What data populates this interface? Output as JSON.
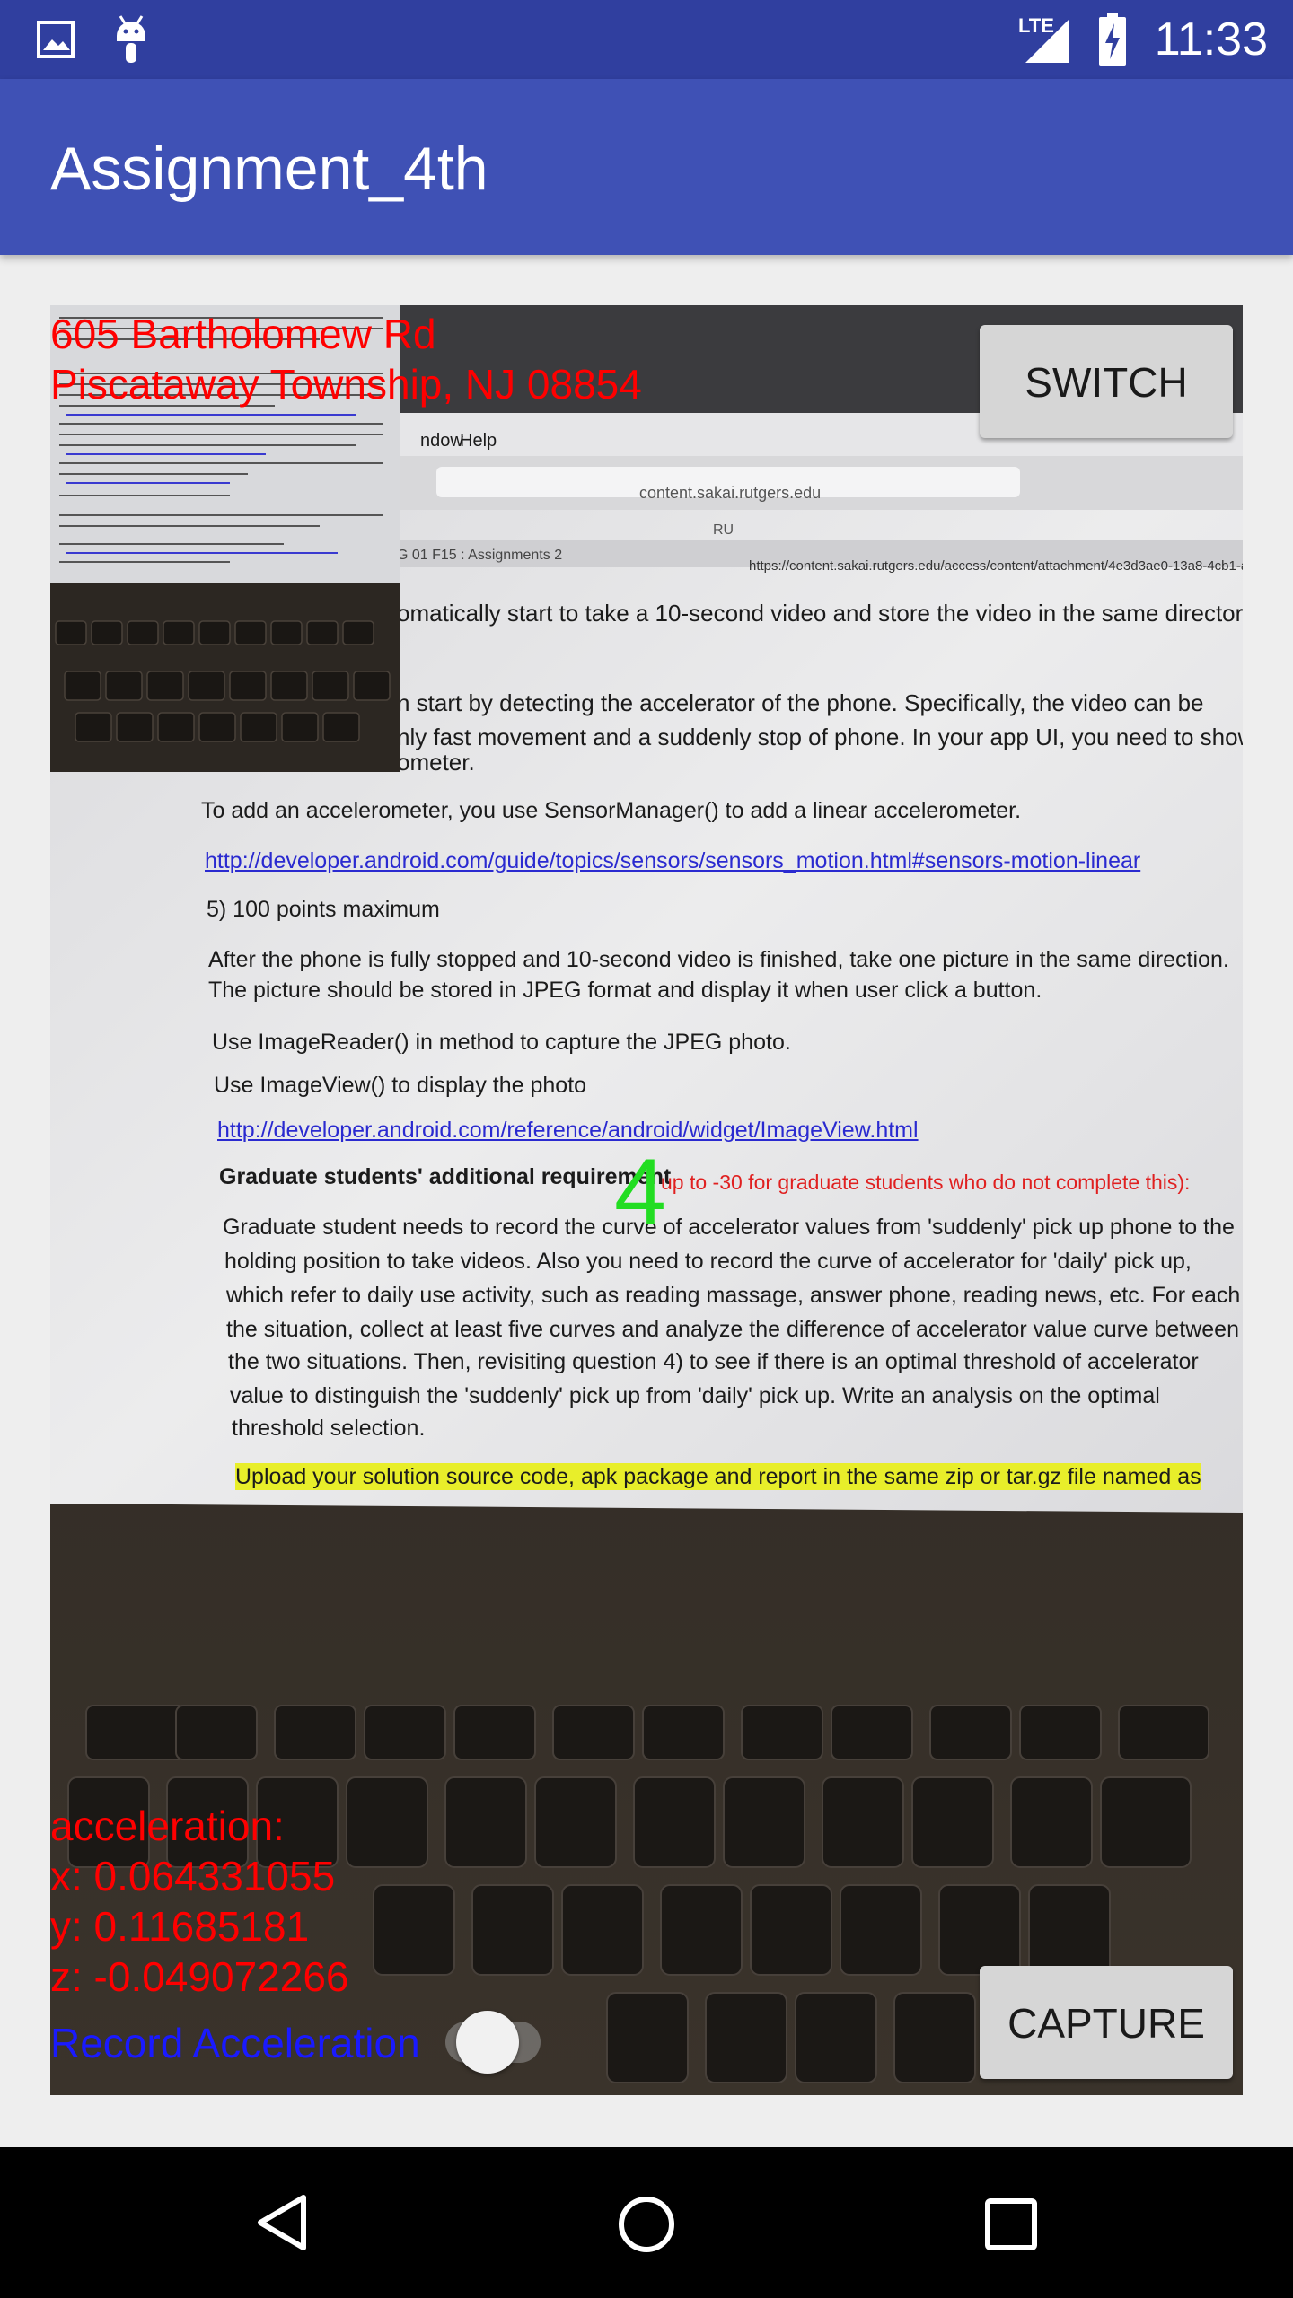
{
  "status_bar": {
    "time": "11:33",
    "network": "LTE",
    "icons": [
      "image-icon",
      "android-icon",
      "signal-icon",
      "battery-charging-icon"
    ]
  },
  "app_bar": {
    "title": "Assignment_4th"
  },
  "camera": {
    "address_line1": "605 Bartholomew Rd",
    "address_line2": "Piscataway Township, NJ 08854",
    "switch_label": "SWITCH",
    "capture_label": "CAPTURE",
    "counter": "4",
    "acceleration": {
      "heading": "acceleration:",
      "x": "x: 0.064331055",
      "y": "y: 0.11685181",
      "z": "z: -0.049072266"
    },
    "record_label": "Record Acceleration",
    "record_enabled": false
  },
  "document": {
    "menu_window": "ndow",
    "menu_help": "Help",
    "url": "content.sakai.rutgers.edu",
    "lang": "RU",
    "tab": "G 01 F15 : Assignments 2",
    "full_url": "https://content.sakai.rutgers.edu/access/content/attachment/4e3d3ae0-13a8-4cb1-a",
    "lines": [
      "omatically start to take a 10-second video and store the video in the same director",
      "n start by detecting the accelerator of the phone. Specifically, the video can be",
      "nly fast movement and a suddenly stop of phone. In your app UI, you need to show",
      "ometer.",
      "To add an accelerometer, you use SensorManager() to add a linear accelerometer."
    ],
    "link1": "http://developer.android.com/guide/topics/sensors/sensors_motion.html#sensors-motion-linear",
    "points": "5) 100 points maximum",
    "para2": [
      "After the phone is fully stopped and 10-second video is finished, take one picture in the same direction.",
      "The picture should be stored in JPEG format and display it when user click a button."
    ],
    "imagereader": "Use ImageReader() in method to capture the JPEG photo.",
    "imageview": "Use ImageView() to display the photo",
    "link2": "http://developer.android.com/reference/android/widget/ImageView.html",
    "grad_heading": "Graduate students' additional requirement",
    "grad_red": "up to -30 for graduate students who do not complete this):",
    "grad_para": [
      "Graduate student needs to record the curve of accelerator values from 'suddenly' pick up phone to the",
      "holding position to take videos. Also you need to record the curve of accelerator for 'daily' pick up,",
      "which refer to daily use activity, such as reading massage, answer phone, reading news, etc. For each of",
      "the situation, collect at least five curves and analyze the difference of accelerator value curve between",
      "the two situations. Then, revisiting question 4) to see if there is an optimal threshold of accelerator",
      "value to distinguish the 'suddenly' pick up from 'daily' pick up. Write an analysis on the optimal",
      "threshold selection."
    ],
    "upload": "Upload your solution source code, apk package and report in the same zip or tar.gz file named as"
  },
  "nav_bar": {
    "icons": [
      "back-icon",
      "home-icon",
      "recents-icon"
    ]
  }
}
